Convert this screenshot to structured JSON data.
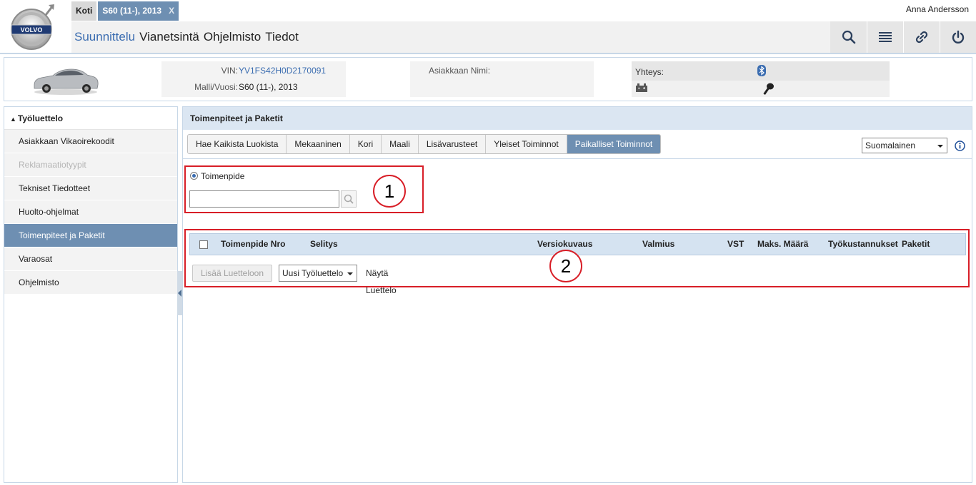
{
  "header": {
    "brand": "VOLVO",
    "tabs": [
      {
        "label": "Koti"
      },
      {
        "label": "S60 (11-), 2013",
        "close": "X"
      }
    ],
    "user": "Anna Andersson",
    "nav": [
      {
        "label": "Suunnittelu",
        "active": true
      },
      {
        "label": "Vianetsintä"
      },
      {
        "label": "Ohjelmisto"
      },
      {
        "label": "Tiedot"
      }
    ],
    "tools": [
      "search-icon",
      "list-icon",
      "link-icon",
      "power-icon"
    ]
  },
  "vehicle": {
    "vin_label": "VIN:",
    "vin": "YV1FS42H0D2170091",
    "model_label": "Malli/Vuosi:",
    "model": "S60 (11-), 2013",
    "customer_label": "Asiakkaan Nimi:",
    "connection_label": "Yhteys:"
  },
  "sidebar": {
    "title": "Työluettelo",
    "items": [
      {
        "label": "Asiakkaan Vikaoirekoodit"
      },
      {
        "label": "Reklamaatiotyypit",
        "disabled": true
      },
      {
        "label": "Tekniset Tiedotteet"
      },
      {
        "label": "Huolto-ohjelmat"
      },
      {
        "label": "Toimenpiteet ja Paketit",
        "active": true
      },
      {
        "label": "Varaosat"
      },
      {
        "label": "Ohjelmisto"
      }
    ]
  },
  "main": {
    "title": "Toimenpiteet ja Paketit",
    "category_tabs": [
      {
        "label": "Hae Kaikista Luokista"
      },
      {
        "label": "Mekaaninen"
      },
      {
        "label": "Kori"
      },
      {
        "label": "Maali"
      },
      {
        "label": "Lisävarusteet"
      },
      {
        "label": "Yleiset Toiminnot"
      },
      {
        "label": "Paikalliset Toiminnot",
        "active": true
      }
    ],
    "language": "Suomalainen",
    "search": {
      "radio_label": "Toimenpide",
      "value": "",
      "placeholder": ""
    },
    "table_columns": [
      "Toimenpide Nro",
      "Selitys",
      "Versiokuvaus",
      "Valmius",
      "VST",
      "Maks. Määrä",
      "Työkustannukset",
      "Paketit"
    ],
    "add_button": "Lisää Luetteloon",
    "worklist_select": "Uusi Työluettelo",
    "show_list": "Näytä Luettelo",
    "callouts": [
      "1",
      "2"
    ]
  },
  "colors": {
    "accent": "#6e8fb2",
    "link": "#3a6cb0",
    "highlight_border": "#d81e27",
    "header_blue": "#dbe6f2"
  }
}
